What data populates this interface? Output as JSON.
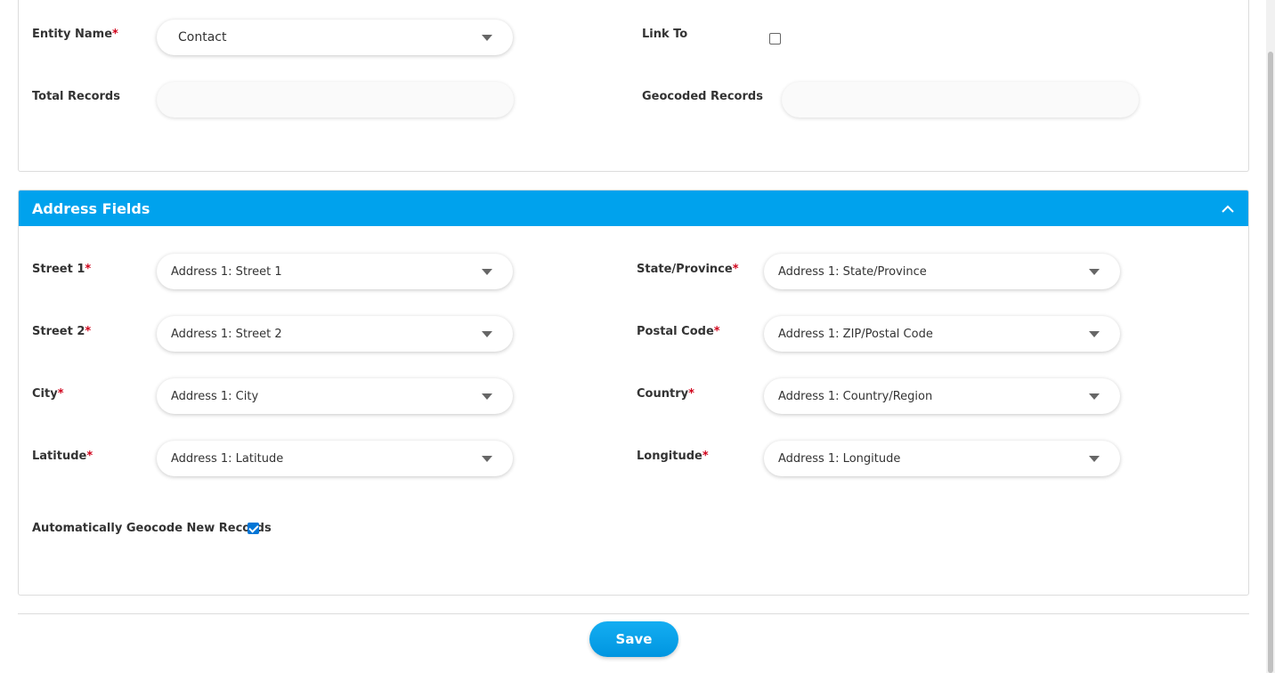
{
  "entity": {
    "entity_name_label": "Entity Name",
    "entity_name_value": "Contact",
    "link_to_label": "Link To",
    "link_to_checked": false,
    "total_records_label": "Total Records",
    "total_records_value": "",
    "geocoded_records_label": "Geocoded Records",
    "geocoded_records_value": ""
  },
  "address_panel": {
    "title": "Address Fields",
    "fields": {
      "street1": {
        "label": "Street 1",
        "value": "Address 1: Street 1"
      },
      "street2": {
        "label": "Street 2",
        "value": "Address 1: Street 2"
      },
      "city": {
        "label": "City",
        "value": "Address 1: City"
      },
      "latitude": {
        "label": "Latitude",
        "value": "Address 1: Latitude"
      },
      "state": {
        "label": "State/Province",
        "value": "Address 1: State/Province"
      },
      "postal": {
        "label": "Postal Code",
        "value": "Address 1: ZIP/Postal Code"
      },
      "country": {
        "label": "Country",
        "value": "Address 1: Country/Region"
      },
      "longitude": {
        "label": "Longitude",
        "value": "Address 1: Longitude"
      }
    },
    "auto_geocode_label": "Automatically Geocode New Records",
    "auto_geocode_checked": true
  },
  "actions": {
    "save_label": "Save"
  },
  "colors": {
    "accent": "#00a2ed",
    "required": "#d0021b"
  }
}
